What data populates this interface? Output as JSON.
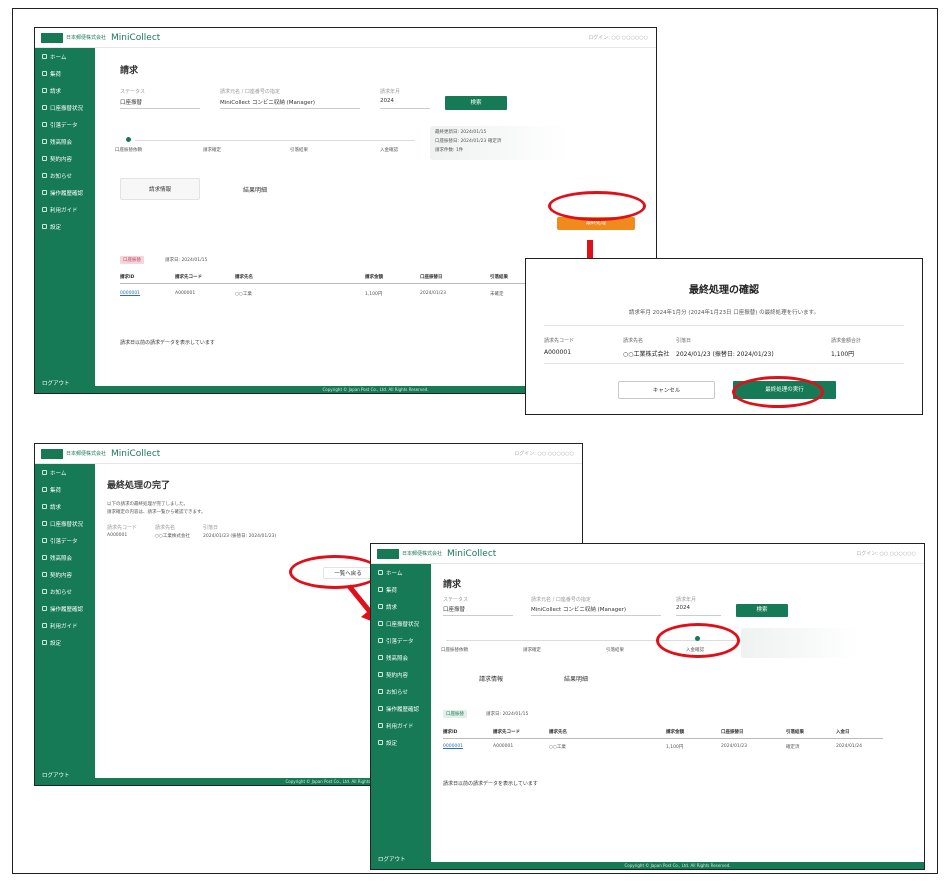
{
  "app": {
    "name": "MiniCollect",
    "brand_sub": "日本郵便株式会社",
    "header_right": "ログイン: ○○ ○○○○○○",
    "footer": "Copyright © Japan Post Co., Ltd. All Rights Reserved.",
    "brand_color": "#167a57",
    "accent_orange": "#f08a1c",
    "highlight_red": "#e0101a"
  },
  "sidebar": {
    "items": [
      {
        "label": "ホーム",
        "icon": "home-icon"
      },
      {
        "label": "集荷",
        "icon": "truck-icon"
      },
      {
        "label": "請求",
        "icon": "invoice-icon"
      },
      {
        "label": "口座振替状況",
        "icon": "bank-icon"
      },
      {
        "label": "引落データ",
        "icon": "download-icon"
      },
      {
        "label": "残高照会",
        "icon": "balance-icon"
      },
      {
        "label": "契約内容",
        "icon": "contract-icon"
      },
      {
        "label": "お知らせ",
        "icon": "bell-icon"
      },
      {
        "label": "操作履歴確認",
        "icon": "history-icon"
      },
      {
        "label": "利用ガイド",
        "icon": "guide-icon"
      },
      {
        "label": "設定",
        "icon": "gear-icon"
      }
    ],
    "logout": "ログアウト"
  },
  "screen1": {
    "title": "請求",
    "fields": [
      {
        "label": "ステータス",
        "value": "口座振替"
      },
      {
        "label": "請求元名 / 口座番号の指定",
        "value": "MiniCollect コンビニ収納 (Manager)"
      },
      {
        "label": "請求年月",
        "value": "2024"
      }
    ],
    "search_button": "検索",
    "steps": [
      "口座振替依頼",
      "請求確定",
      "引落結果",
      "入金確認"
    ],
    "info_lines": [
      "最終更新日: 2024/01/15",
      "口座振替日: 2024/01/23 確定済",
      "請求件数: 1件"
    ],
    "tabs": [
      "請求情報",
      "結果明細"
    ],
    "final_button": "最終処理",
    "tag": "口座振替",
    "tag_note": "請求日: 2024/01/15",
    "table_headers": [
      "請求ID",
      "請求先コード",
      "請求先名",
      "請求金額",
      "口座振替日",
      "引落結果"
    ],
    "table_row": [
      "0000001",
      "A000001",
      "○○工業",
      "1,100円",
      "2024/01/23",
      "未確定"
    ],
    "footnote": "請求日以前の請求データを表示しています"
  },
  "dialog": {
    "title": "最終処理の確認",
    "subtitle": "請求年月 2024年1月分 (2024年1月23日 口座振替) の最終処理を行います。",
    "labels": [
      "請求先コード",
      "請求先名",
      "引落日",
      "請求金額合計"
    ],
    "values": [
      "A000001",
      "○○工業株式会社",
      "2024/01/23 (振替日: 2024/01/23)",
      "1,100円"
    ],
    "cancel": "キャンセル",
    "confirm": "最終処理の実行"
  },
  "screen2": {
    "title": "最終処理の完了",
    "messages": [
      "以下の請求の最終処理が完了しました。",
      "請求確定の内容は、請求一覧から確認できます。"
    ],
    "labels": [
      "請求先コード",
      "請求先名",
      "引落日"
    ],
    "values": [
      "A000001",
      "○○工業株式会社",
      "2024/01/23 (振替日: 2024/01/23)"
    ],
    "back_button": "一覧へ戻る"
  },
  "screen3": {
    "title": "請求",
    "fields": [
      {
        "label": "ステータス",
        "value": "口座振替"
      },
      {
        "label": "請求元名 / 口座番号の指定",
        "value": "MiniCollect コンビニ収納 (Manager)"
      },
      {
        "label": "請求年月",
        "value": "2024"
      }
    ],
    "search_button": "検索",
    "steps": [
      "口座振替依頼",
      "請求確定",
      "引落結果",
      "入金確認"
    ],
    "tabs": [
      "請求情報",
      "結果明細"
    ],
    "tag": "口座振替",
    "tag_note": "請求日: 2024/01/15",
    "table_headers": [
      "請求ID",
      "請求先コード",
      "請求先名",
      "請求金額",
      "口座振替日",
      "引落結果",
      "入金日"
    ],
    "table_row": [
      "0000001",
      "A000001",
      "○○工業",
      "1,100円",
      "2024/01/23",
      "確定済",
      "2024/01/24"
    ],
    "footnote": "請求日以前の請求データを表示しています"
  }
}
